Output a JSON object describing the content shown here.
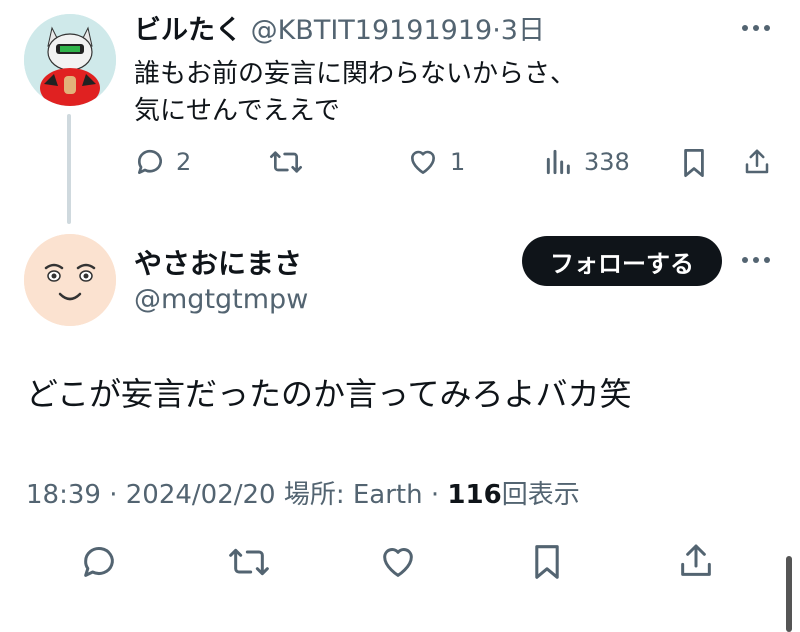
{
  "parent_tweet": {
    "author_name": "ビルたく",
    "handle": "@KBTIT19191919",
    "separator": "·",
    "time": "3日",
    "text_line1": "誰もお前の妄言に関わらないからさ、",
    "text_line2": "気にせんでええで",
    "actions": {
      "reply_count": "2",
      "retweet_count": "",
      "like_count": "1",
      "view_count": "338"
    }
  },
  "reply_tweet": {
    "author_name": "やさおにまさ",
    "handle": "@mgtgtmpw",
    "follow_label": "フォローする",
    "text": "どこが妄言だったのか言ってみろよバカ笑",
    "meta": {
      "time": "18:39",
      "sep1": "·",
      "date": "2024/02/20",
      "location_label": "場所: Earth",
      "sep2": "·",
      "views_count": "116",
      "views_label": "回表示"
    }
  },
  "icons": [
    "more-icon",
    "reply-icon",
    "retweet-icon",
    "like-icon",
    "views-icon",
    "bookmark-icon",
    "share-icon"
  ],
  "colors": {
    "text": "#0f1419",
    "secondary": "#536471",
    "follow_bg": "#0f1419",
    "thread_line": "#cfd9de"
  }
}
